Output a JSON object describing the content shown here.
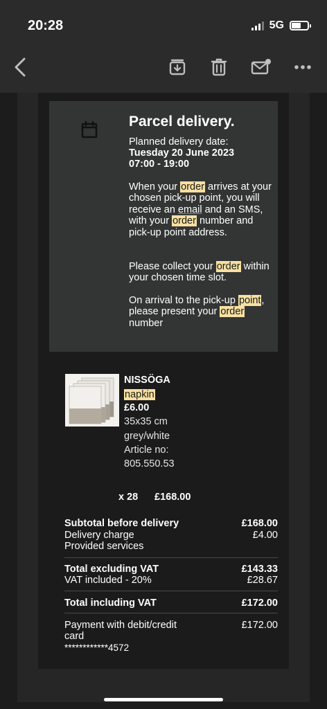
{
  "status": {
    "time": "20:28",
    "network": "5G"
  },
  "appbar": {
    "back_icon": "chevron-left-icon",
    "archive_icon": "archive-download-icon",
    "trash_icon": "trash-icon",
    "mark_icon": "mail-unread-icon",
    "more_icon": "ellipsis-icon"
  },
  "delivery": {
    "icon": "calendar-icon",
    "title": "Parcel delivery.",
    "planned_label": "Planned delivery date:",
    "date": "Tuesday 20 June 2023",
    "window": "07:00 - 19:00",
    "p1": {
      "a": "When your ",
      "order1": "order",
      "b": " arrives at your chosen pick-up point, you will receive an ",
      "email": "email",
      "c": " and an SMS, with your ",
      "order2": "order",
      "d": " number and pick-up point address."
    },
    "p2": {
      "a": "Please collect your ",
      "order": "order",
      "b": " within your chosen time slot."
    },
    "p3": {
      "a": "On arrival to the pick-up ",
      "point": "point",
      "b": ", please present your ",
      "order": "order",
      "c": " number"
    }
  },
  "product": {
    "name": "NISSÖGA",
    "type": "napkin",
    "price": "£6.00",
    "size": "35x35 cm",
    "color": "grey/white",
    "article_label": "Article no:",
    "article_no": "805.550.53",
    "quantity": "x 28",
    "line_total": "£168.00"
  },
  "summary": {
    "subtotal_label": "Subtotal before delivery",
    "subtotal_value": "£168.00",
    "delivery_label": "Delivery charge",
    "delivery_value": "£4.00",
    "services_label": "Provided services",
    "excl_vat_label": "Total excluding VAT",
    "excl_vat_value": "£143.33",
    "vat_label": "VAT included - 20%",
    "vat_value": "£28.67",
    "incl_vat_label": "Total including VAT",
    "incl_vat_value": "£172.00",
    "payment_label_line1": "Payment with debit/credit",
    "payment_label_line2": "card",
    "payment_value": "£172.00",
    "card_number": "************4572"
  },
  "colors": {
    "highlight": "#f7e0a1",
    "delivery_box": "#333535",
    "background": "#1c1c1d"
  }
}
